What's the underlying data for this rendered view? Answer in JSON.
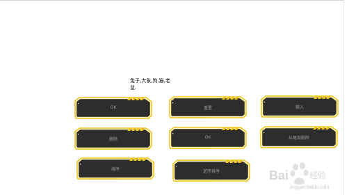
{
  "label_text": "兔子,大象,狗,猫,老鼠.",
  "buttons": [
    {
      "label": "OK"
    },
    {
      "label": "重置"
    },
    {
      "label": "输入"
    },
    {
      "label": "删除"
    },
    {
      "label": "OK"
    },
    {
      "label": "从尾部删除"
    },
    {
      "label": "排序"
    },
    {
      "label": "逆序排序"
    }
  ],
  "watermark": {
    "brand": "Bai",
    "brand2": "经验",
    "url": "jingyan.baidu.com"
  },
  "colors": {
    "button_fill": "#2d2d2d",
    "button_border": "#f0c419",
    "background": "#ffffff"
  }
}
